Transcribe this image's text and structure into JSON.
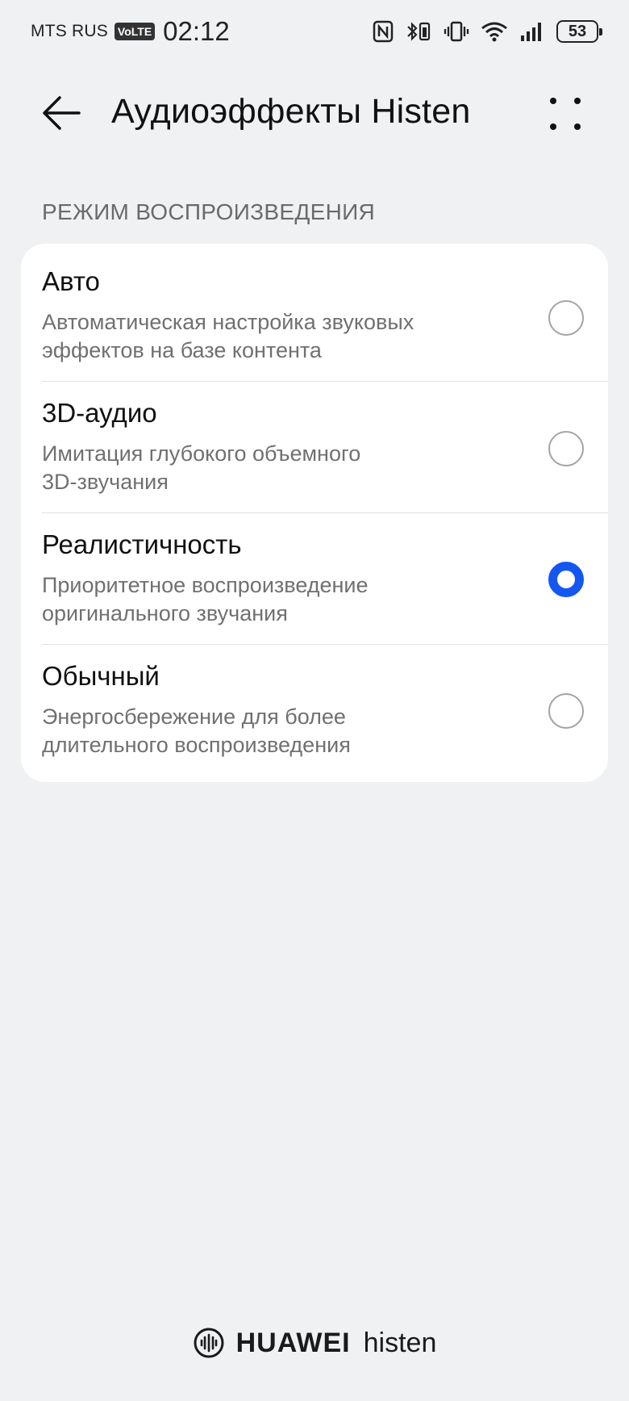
{
  "status_bar": {
    "carrier": "MTS RUS",
    "volte": "VoLTE",
    "time": "02:12",
    "battery": "53",
    "icons": [
      "nfc-icon",
      "bluetooth-icon",
      "vibrate-icon",
      "wifi-icon",
      "signal-icon",
      "battery-icon"
    ]
  },
  "header": {
    "title": "Аудиоэффекты Histen",
    "back_icon": "arrow-left-icon",
    "more_icon": "more-dots-icon"
  },
  "section": {
    "label": "РЕЖИМ ВОСПРОИЗВЕДЕНИЯ"
  },
  "options": [
    {
      "title": "Авто",
      "desc_line1": "Автоматическая настройка звуковых",
      "desc_line2": "эффектов на базе контента",
      "selected": false
    },
    {
      "title": "3D-аудио",
      "desc_line1": "Имитация глубокого объемного",
      "desc_line2": "3D-звучания",
      "selected": false
    },
    {
      "title": "Реалистичность",
      "desc_line1": "Приоритетное воспроизведение",
      "desc_line2": "оригинального звучания",
      "selected": true
    },
    {
      "title": "Обычный",
      "desc_line1": "Энергосбережение для более",
      "desc_line2": "длительного воспроизведения",
      "selected": false
    }
  ],
  "footer": {
    "brand_main": "HUAWEI",
    "brand_sub": "histen"
  },
  "colors": {
    "accent": "#1457f0",
    "background": "#f0f1f3",
    "card": "#ffffff"
  }
}
